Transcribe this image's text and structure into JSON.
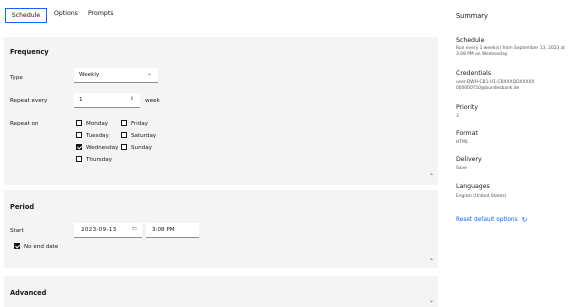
{
  "tabs": [
    {
      "label": "Schedule"
    },
    {
      "label": "Options"
    },
    {
      "label": "Prompts"
    }
  ],
  "frequency": {
    "title": "Frequency",
    "type_label": "Type",
    "type_value": "Weekly",
    "repeat_every_label": "Repeat every",
    "repeat_every_value": "1",
    "repeat_every_unit": "week",
    "repeat_on_label": "Repeat on",
    "days": [
      {
        "label": "Monday",
        "checked": false
      },
      {
        "label": "Tuesday",
        "checked": false
      },
      {
        "label": "Wednesday",
        "checked": true
      },
      {
        "label": "Thursday",
        "checked": false
      },
      {
        "label": "Friday",
        "checked": false
      },
      {
        "label": "Saturday",
        "checked": false
      },
      {
        "label": "Sunday",
        "checked": false
      }
    ]
  },
  "period": {
    "title": "Period",
    "start_label": "Start",
    "start_date": "2023-09-13",
    "start_time": "3:08 PM",
    "no_end_date_label": "No end date",
    "no_end_date_checked": true
  },
  "advanced": {
    "title": "Advanced"
  },
  "summary": {
    "title": "Summary",
    "schedule_label": "Schedule",
    "schedule_value": "Run every 1 week(s) from September 13, 2023 at 3:08 PM on Wednesday.",
    "credentials_label": "Credentials",
    "credentials_value_1": "user-DWH-CB1-U1-CBXXXQDXXXXX",
    "credentials_value_2": "000000T10@bundesbank.de",
    "priority_label": "Priority",
    "priority_value": "3",
    "format_label": "Format",
    "format_value": "HTML",
    "delivery_label": "Delivery",
    "delivery_value": "Save",
    "languages_label": "Languages",
    "languages_value": "English (United States)",
    "reset_label": "Reset default options"
  },
  "colors": {
    "accent": "#0f62fe",
    "panel_bg": "#f4f4f4"
  }
}
